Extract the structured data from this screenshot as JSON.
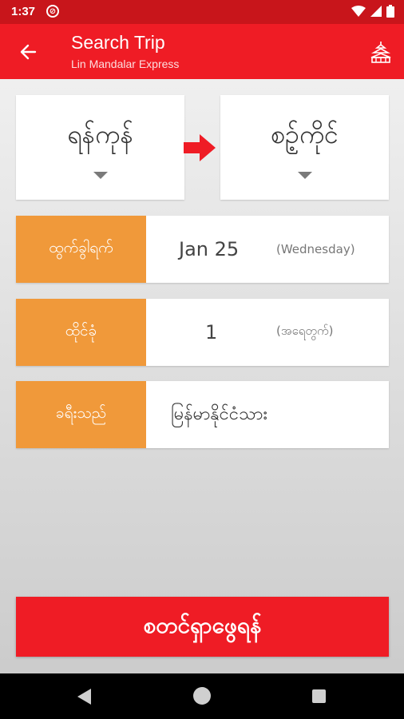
{
  "status_bar": {
    "time": "1:37"
  },
  "header": {
    "title": "Search Trip",
    "subtitle": "Lin Mandalar Express"
  },
  "route": {
    "from": "ရန်ကုန်",
    "to": "စဥ့်ကိုင်"
  },
  "form": {
    "date": {
      "label": "ထွက်ခွါရက်",
      "value": "Jan 25",
      "note": "(Wednesday)"
    },
    "seats": {
      "label": "ထိုင်ခုံ",
      "value": "1",
      "note": "(အရေတွက်)"
    },
    "traveler": {
      "label": "ခရီးသည်",
      "value": "မြန်မာနိုင်ငံသား"
    }
  },
  "search_button": {
    "label": "စတင်ရှာဖွေရန်"
  },
  "colors": {
    "status_bar": "#c8151b",
    "primary": "#ef1c25",
    "accent": "#f0993a"
  }
}
